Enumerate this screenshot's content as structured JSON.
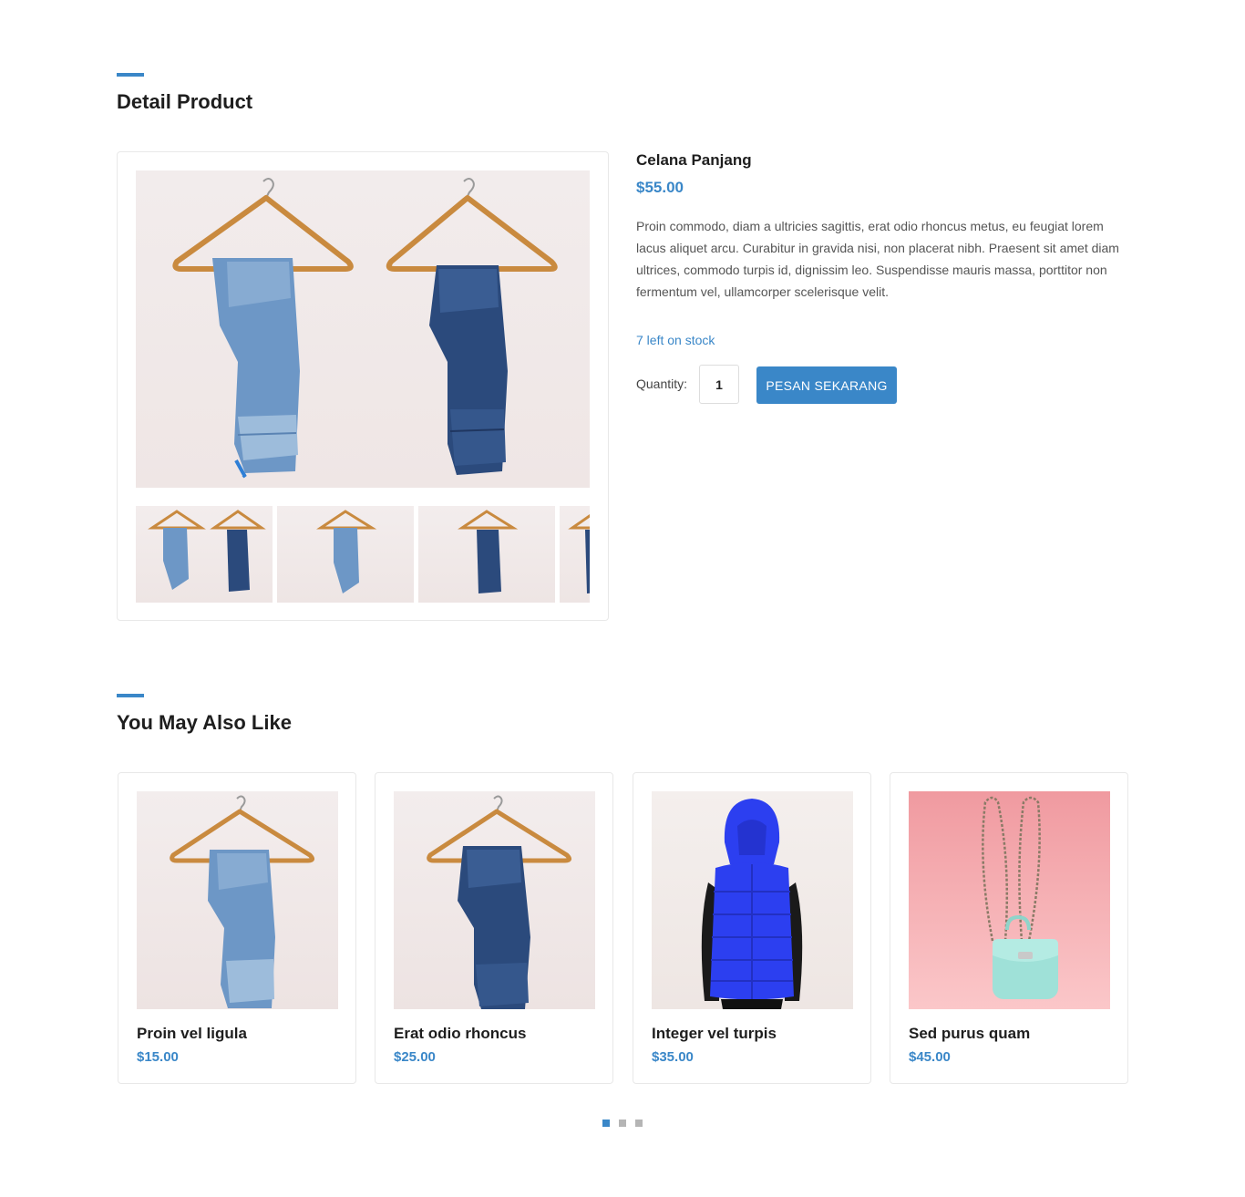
{
  "detail": {
    "section_title": "Detail Product",
    "product": {
      "name": "Celana Panjang",
      "price": "$55.00",
      "description": "Proin commodo, diam a ultricies sagittis, erat odio rhoncus metus, eu feugiat lorem lacus aliquet arcu. Curabitur in gravida nisi, non placerat nibh. Praesent sit amet diam ultrices, commodo turpis id, dignissim leo. Suspendisse mauris massa, porttitor non fermentum vel, ullamcorper scelerisque velit.",
      "stock": "7 left on stock",
      "quantity_label": "Quantity:",
      "quantity_value": "1",
      "order_button": "PESAN SEKARANG"
    }
  },
  "related": {
    "section_title": "You May Also Like",
    "items": [
      {
        "name": "Proin vel ligula",
        "price": "$15.00"
      },
      {
        "name": "Erat odio rhoncus",
        "price": "$25.00"
      },
      {
        "name": "Integer vel turpis",
        "price": "$35.00"
      },
      {
        "name": "Sed purus quam",
        "price": "$45.00"
      }
    ]
  },
  "carousel": {
    "pages": 3,
    "active_page": 1
  },
  "colors": {
    "accent": "#3a87c8",
    "light_denim": "#6d97c6",
    "dark_denim": "#2b4a7c",
    "vest_blue": "#2c3ff0",
    "bag_mint": "#9fe1d8",
    "bag_bg_pink": "#f6b6b8"
  }
}
